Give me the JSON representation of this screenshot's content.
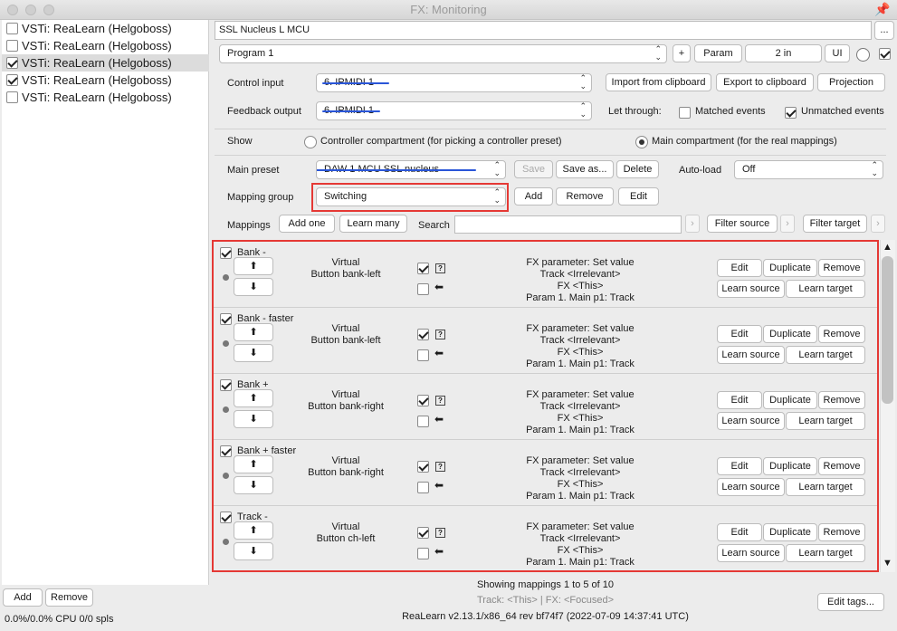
{
  "window": {
    "title": "FX: Monitoring"
  },
  "fx_list": [
    {
      "label": "VSTi: ReaLearn (Helgoboss)",
      "checked": false,
      "selected": false
    },
    {
      "label": "VSTi: ReaLearn (Helgoboss)",
      "checked": false,
      "selected": false
    },
    {
      "label": "VSTi: ReaLearn (Helgoboss)",
      "checked": true,
      "selected": true
    },
    {
      "label": "VSTi: ReaLearn (Helgoboss)",
      "checked": true,
      "selected": false
    },
    {
      "label": "VSTi: ReaLearn (Helgoboss)",
      "checked": false,
      "selected": false
    }
  ],
  "bottom_left": {
    "add": "Add",
    "remove": "Remove",
    "cpu": "0.0%/0.0% CPU 0/0 spls"
  },
  "header": {
    "preset_name": "SSL Nucleus L MCU",
    "ellipsis": "...",
    "program": "Program 1",
    "plus": "+",
    "param": "Param",
    "io": "2 in",
    "ui": "UI"
  },
  "control_input": {
    "label": "Control input",
    "value": "6. IPMIDI 1"
  },
  "feedback_output": {
    "label": "Feedback output",
    "value": "6. IPMIDI 1"
  },
  "clipboard": {
    "import": "Import from clipboard",
    "export": "Export to clipboard",
    "projection": "Projection"
  },
  "let_through": {
    "label": "Let through:",
    "matched": "Matched events",
    "unmatched": "Unmatched events"
  },
  "show": {
    "label": "Show",
    "controller": "Controller compartment (for picking a controller preset)",
    "main": "Main compartment (for the real mappings)"
  },
  "main_preset": {
    "label": "Main preset",
    "value": "DAW 1 MCU SSL nucleus",
    "save": "Save",
    "save_as": "Save as...",
    "delete": "Delete"
  },
  "auto_load": {
    "label": "Auto-load",
    "value": "Off"
  },
  "mapping_group": {
    "label": "Mapping group",
    "value": "Switching",
    "add": "Add",
    "remove": "Remove",
    "edit": "Edit"
  },
  "mappings_bar": {
    "label": "Mappings",
    "add_one": "Add one",
    "learn_many": "Learn many",
    "search_label": "Search",
    "search_value": "",
    "filter_source": "Filter source",
    "filter_target": "Filter target",
    "arrow": "›"
  },
  "mapping_rows": [
    {
      "name": "Bank -",
      "source_line1": "Virtual",
      "source_line2": "Button bank-left",
      "target": [
        "FX parameter: Set value",
        "Track <Irrelevant>",
        "FX <This>",
        "Param 1. Main p1: Track"
      ]
    },
    {
      "name": "Bank - faster",
      "source_line1": "Virtual",
      "source_line2": "Button bank-left",
      "target": [
        "FX parameter: Set value",
        "Track <Irrelevant>",
        "FX <This>",
        "Param 1. Main p1: Track"
      ]
    },
    {
      "name": "Bank +",
      "source_line1": "Virtual",
      "source_line2": "Button bank-right",
      "target": [
        "FX parameter: Set value",
        "Track <Irrelevant>",
        "FX <This>",
        "Param 1. Main p1: Track"
      ]
    },
    {
      "name": "Bank + faster",
      "source_line1": "Virtual",
      "source_line2": "Button bank-right",
      "target": [
        "FX parameter: Set value",
        "Track <Irrelevant>",
        "FX <This>",
        "Param 1. Main p1: Track"
      ]
    },
    {
      "name": "Track -",
      "source_line1": "Virtual",
      "source_line2": "Button ch-left",
      "target": [
        "FX parameter: Set value",
        "Track <Irrelevant>",
        "FX <This>",
        "Param 1. Main p1: Track"
      ]
    }
  ],
  "row_buttons": {
    "up": "⬆",
    "down": "⬇",
    "q": "?",
    "left_arrow": "⬅",
    "edit": "Edit",
    "duplicate": "Duplicate",
    "remove": "Remove",
    "learn_source": "Learn source",
    "learn_target": "Learn target"
  },
  "footer": {
    "showing": "Showing mappings 1 to 5 of 10",
    "context": "Track: <This> | FX: <Focused>",
    "version": "ReaLearn v2.13.1/x86_64 rev bf74f7 (2022-07-09 14:37:41 UTC)",
    "edit_tags": "Edit tags..."
  },
  "colors": {
    "annotation_red": "#e53935",
    "scribble_blue": "#2a56d8"
  }
}
